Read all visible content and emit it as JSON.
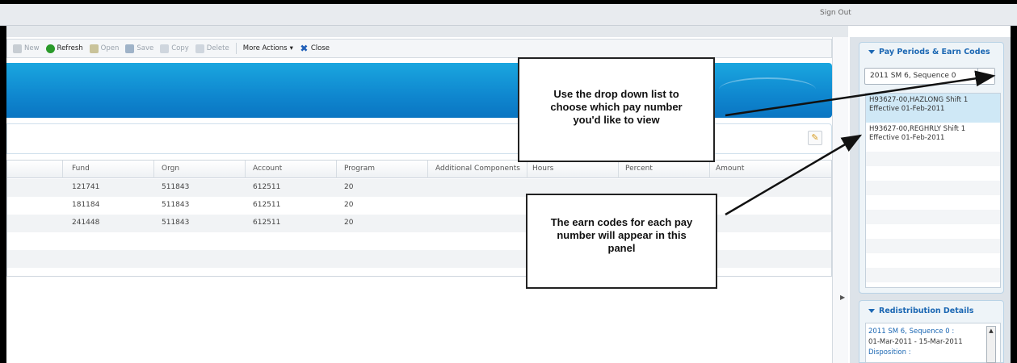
{
  "header": {
    "sign_out": "Sign Out"
  },
  "toolbar": {
    "new": "New",
    "refresh": "Refresh",
    "open": "Open",
    "save": "Save",
    "copy": "Copy",
    "delete": "Delete",
    "more_actions": "More Actions",
    "close": "Close"
  },
  "grid": {
    "columns": [
      "Fund",
      "Orgn",
      "Account",
      "Program",
      "Additional Components",
      "Hours",
      "Percent",
      "Amount"
    ],
    "rows": [
      {
        "fund": "121741",
        "orgn": "511843",
        "account": "612511",
        "program": "20"
      },
      {
        "fund": "181184",
        "orgn": "511843",
        "account": "612511",
        "program": "20"
      },
      {
        "fund": "241448",
        "orgn": "511843",
        "account": "612511",
        "program": "20"
      }
    ]
  },
  "right_panel": {
    "pay_periods_title": "Pay Periods & Earn Codes",
    "pay_period_selected": "2011 SM 6, Sequence 0",
    "earn_codes": [
      {
        "line1": "H93627-00,HAZLONG Shift 1",
        "line2": "Effective 01-Feb-2011"
      },
      {
        "line1": "H93627-00,REGHRLY Shift 1",
        "line2": "Effective 01-Feb-2011"
      }
    ],
    "redistribution_title": "Redistribution Details",
    "redistribution_line1": "2011 SM 6, Sequence 0 :",
    "redistribution_line2": "01-Mar-2011 - 15-Mar-2011",
    "redistribution_line3": "Disposition :"
  },
  "callouts": {
    "dropdown": [
      "Use the drop down list to",
      "choose which pay number",
      "you'd like to view"
    ],
    "earn_codes": [
      "The earn codes for each pay",
      "number will appear in this",
      "panel"
    ]
  },
  "colors": {
    "accent_blue": "#1b67b3",
    "banner_blue": "#0f87cf",
    "refresh_green": "#2a9a2a"
  }
}
